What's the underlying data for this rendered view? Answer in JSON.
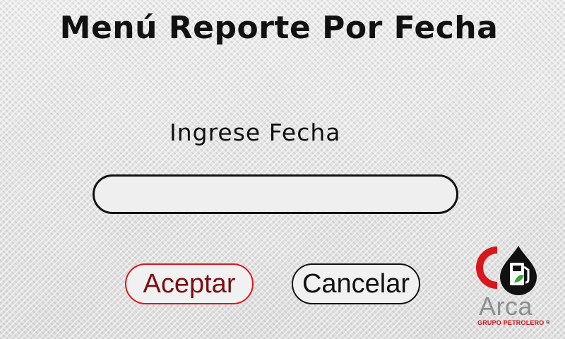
{
  "header": {
    "title": "Menú Reporte Por Fecha"
  },
  "form": {
    "prompt": "Ingrese Fecha",
    "date_value": "",
    "date_placeholder": ""
  },
  "buttons": {
    "accept_label": "Aceptar",
    "cancel_label": "Cancelar"
  },
  "logo": {
    "name": "Arca",
    "subtitle": "GRUPO PETROLERO",
    "registered_mark": "®",
    "icon": "fuel-pump-drop-icon"
  },
  "colors": {
    "brand_red": "#d9161c",
    "brand_gray": "#8e8e8e",
    "text": "#111111"
  }
}
